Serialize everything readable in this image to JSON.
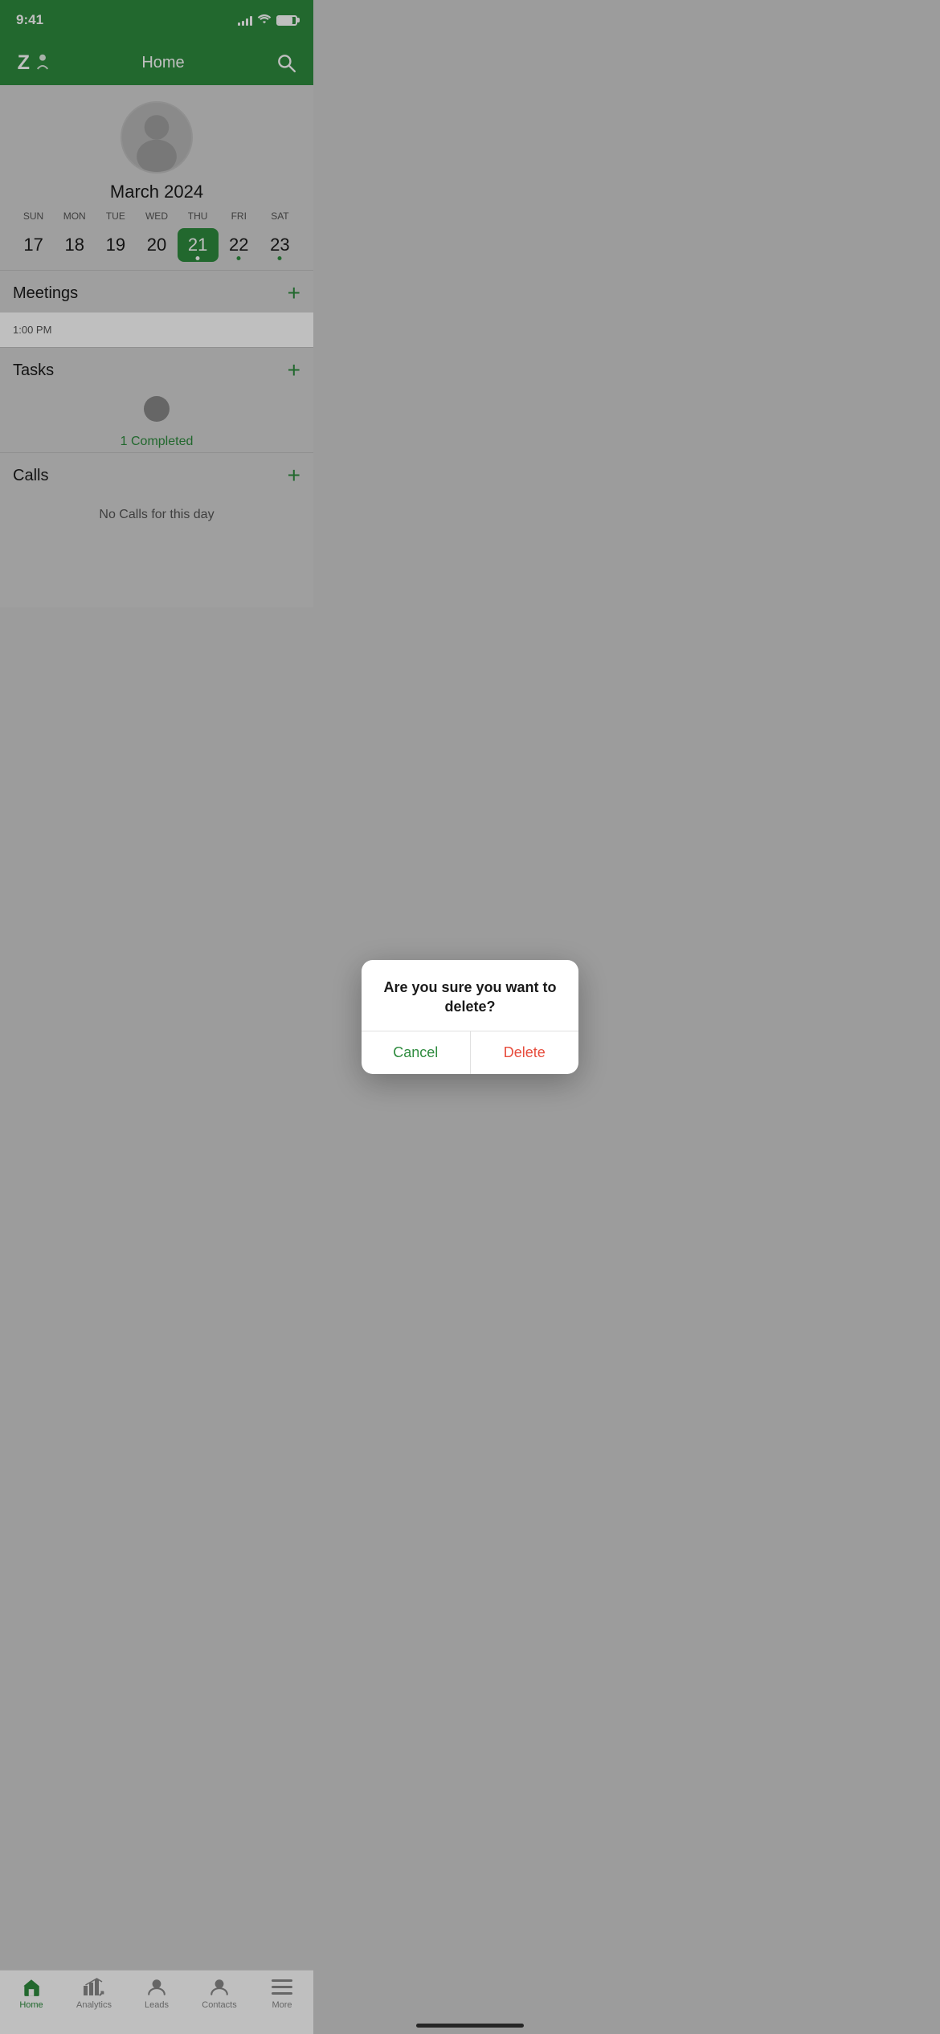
{
  "status": {
    "time": "9:41",
    "signal": [
      3,
      5,
      7,
      9,
      11
    ],
    "battery_percent": 80
  },
  "header": {
    "title": "Home",
    "logo_alt": "Zoho logo",
    "search_label": "search"
  },
  "calendar": {
    "month_year": "March 2024",
    "weekdays": [
      "SUN",
      "MON",
      "TUE",
      "WED",
      "THU",
      "FRI",
      "SAT"
    ],
    "days": [
      {
        "number": "17",
        "active": false,
        "dot": false
      },
      {
        "number": "18",
        "active": false,
        "dot": false
      },
      {
        "number": "19",
        "active": false,
        "dot": false
      },
      {
        "number": "20",
        "active": false,
        "dot": false
      },
      {
        "number": "21",
        "active": true,
        "dot": true
      },
      {
        "number": "22",
        "active": false,
        "dot": true
      },
      {
        "number": "23",
        "active": false,
        "dot": true
      }
    ]
  },
  "sections": {
    "meetings": {
      "title": "Meetings",
      "add_label": "+",
      "item_time": "1:00 PM"
    },
    "tasks": {
      "title": "Tasks",
      "add_label": "+",
      "completed_text": "1 Completed"
    },
    "calls": {
      "title": "Calls",
      "add_label": "+",
      "empty_text": "No Calls for this day"
    }
  },
  "dialog": {
    "message": "Are you sure you want to delete?",
    "cancel_label": "Cancel",
    "delete_label": "Delete"
  },
  "tab_bar": {
    "items": [
      {
        "id": "home",
        "label": "Home",
        "active": true
      },
      {
        "id": "analytics",
        "label": "Analytics",
        "active": false
      },
      {
        "id": "leads",
        "label": "Leads",
        "active": false
      },
      {
        "id": "contacts",
        "label": "Contacts",
        "active": false
      },
      {
        "id": "more",
        "label": "More",
        "active": false
      }
    ]
  }
}
